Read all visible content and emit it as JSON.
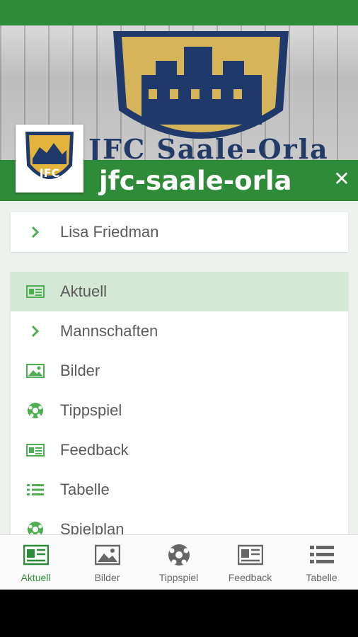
{
  "colors": {
    "primary": "#2e8b38",
    "active_bg": "#d5e7d5",
    "icon_green": "#4caf50"
  },
  "header": {
    "banner_text": "JFC Saale-Orla",
    "logo_text": "JFC",
    "title": "jfc-saale-orla",
    "close_icon": "close-icon"
  },
  "user": {
    "name": "Lisa Friedman",
    "icon": "chevron-right-icon"
  },
  "menu": [
    {
      "label": "Aktuell",
      "icon": "newspaper-icon",
      "active": true
    },
    {
      "label": "Mannschaften",
      "icon": "chevron-right-icon",
      "active": false
    },
    {
      "label": "Bilder",
      "icon": "image-icon",
      "active": false
    },
    {
      "label": "Tippspiel",
      "icon": "soccer-ball-icon",
      "active": false
    },
    {
      "label": "Feedback",
      "icon": "newspaper-icon",
      "active": false
    },
    {
      "label": "Tabelle",
      "icon": "list-icon",
      "active": false
    },
    {
      "label": "Spielplan",
      "icon": "soccer-ball-icon",
      "active": false
    }
  ],
  "bottom_nav": [
    {
      "label": "Aktuell",
      "icon": "newspaper-icon",
      "active": true
    },
    {
      "label": "Bilder",
      "icon": "image-icon",
      "active": false
    },
    {
      "label": "Tippspiel",
      "icon": "soccer-ball-icon",
      "active": false
    },
    {
      "label": "Feedback",
      "icon": "newspaper-icon",
      "active": false
    },
    {
      "label": "Tabelle",
      "icon": "list-icon",
      "active": false
    }
  ]
}
